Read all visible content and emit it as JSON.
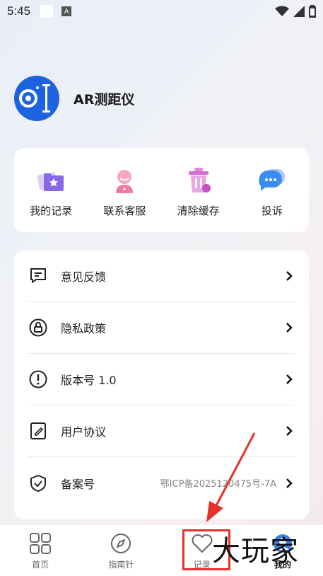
{
  "status_bar": {
    "time": "5:45",
    "a_badge": "A"
  },
  "app": {
    "name": "AR测距仪"
  },
  "quick_actions": [
    {
      "label": "我的记录",
      "icon": "folder-star-icon"
    },
    {
      "label": "联系客服",
      "icon": "customer-service-icon"
    },
    {
      "label": "清除缓存",
      "icon": "trash-bin-icon"
    },
    {
      "label": "投诉",
      "icon": "chat-bubble-icon"
    }
  ],
  "menu": [
    {
      "label": "意见反馈",
      "icon": "feedback-icon",
      "value": ""
    },
    {
      "label": "隐私政策",
      "icon": "lock-icon",
      "value": ""
    },
    {
      "label": "版本号 1.0",
      "icon": "info-icon",
      "value": ""
    },
    {
      "label": "用户协议",
      "icon": "document-icon",
      "value": ""
    },
    {
      "label": "备案号",
      "icon": "shield-check-icon",
      "value": "鄂ICP备2025120475号-7A"
    }
  ],
  "tabs": [
    {
      "label": "首页",
      "icon": "grid-icon",
      "active": false
    },
    {
      "label": "指南针",
      "icon": "compass-icon",
      "active": false
    },
    {
      "label": "记录",
      "icon": "heart-icon",
      "active": false
    },
    {
      "label": "我的",
      "icon": "profile-icon",
      "active": true
    }
  ],
  "watermark": "大玩家",
  "colors": {
    "brand": "#1d63e0",
    "annotation": "#e4312b"
  }
}
